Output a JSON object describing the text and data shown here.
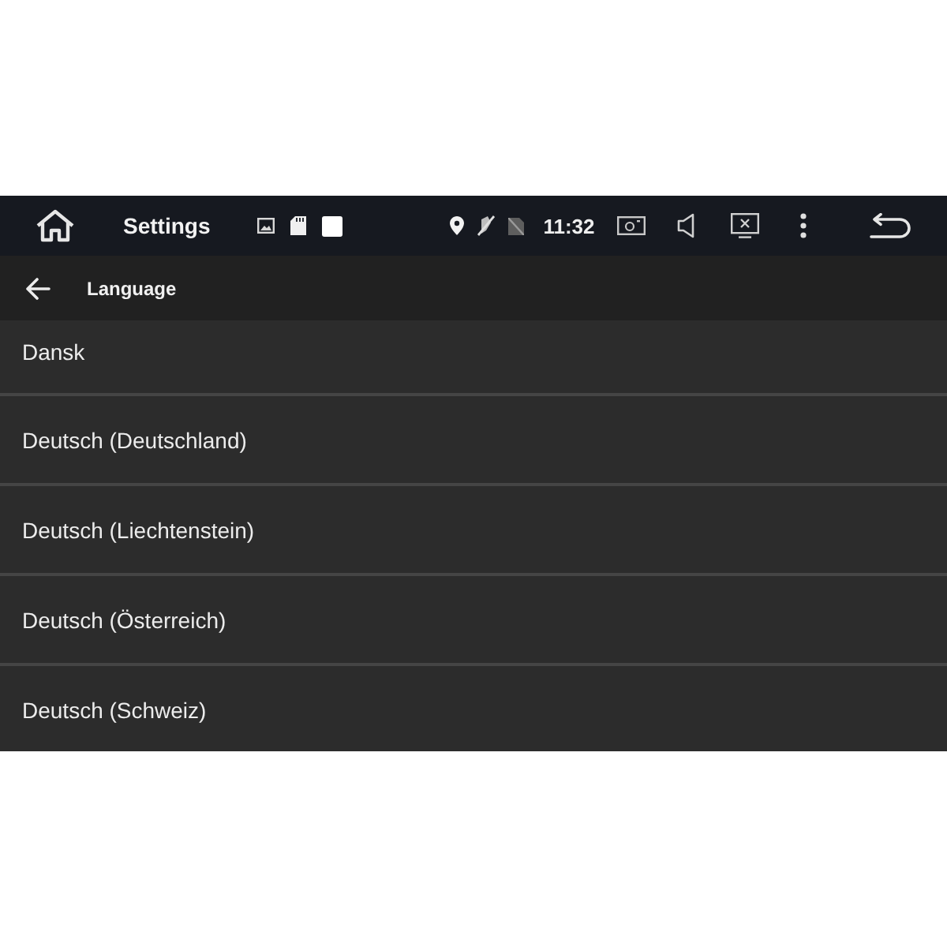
{
  "status_bar": {
    "title": "Settings",
    "time": "11:32"
  },
  "app_bar": {
    "title": "Language"
  },
  "languages": [
    {
      "label": "Dansk"
    },
    {
      "label": "Deutsch (Deutschland)"
    },
    {
      "label": "Deutsch (Liechtenstein)"
    },
    {
      "label": "Deutsch (Österreich)"
    },
    {
      "label": "Deutsch (Schweiz)"
    }
  ]
}
